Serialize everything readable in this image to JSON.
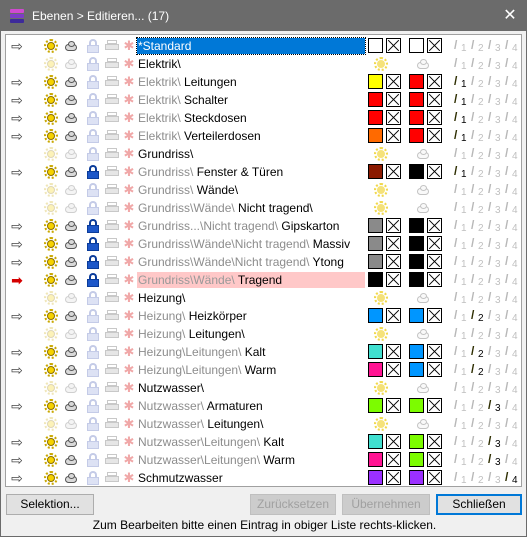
{
  "window": {
    "title": "Ebenen > Editieren... (17)",
    "close_glyph": "✕"
  },
  "layers": [
    {
      "arrow": "⇨",
      "visible": true,
      "locked": false,
      "path": "",
      "name": "*Standard",
      "selected": true,
      "colors": [
        "#ffffff",
        "#ffffff"
      ],
      "widths": [
        1,
        2,
        3,
        4
      ],
      "active_width": 0
    },
    {
      "arrow": "",
      "visible": false,
      "locked": false,
      "path": "",
      "name": "Elektrik\\",
      "group": true
    },
    {
      "arrow": "⇨",
      "visible": true,
      "locked": false,
      "path": "Elektrik\\ ",
      "name": "Leitungen",
      "colors": [
        "#ffff00",
        "#ff0000"
      ],
      "widths": [
        1,
        2,
        3,
        4
      ],
      "active_width": 1
    },
    {
      "arrow": "⇨",
      "visible": true,
      "locked": false,
      "path": "Elektrik\\ ",
      "name": "Schalter",
      "colors": [
        "#ff0000",
        "#ff0000"
      ],
      "widths": [
        1,
        2,
        3,
        4
      ],
      "active_width": 1
    },
    {
      "arrow": "⇨",
      "visible": true,
      "locked": false,
      "path": "Elektrik\\ ",
      "name": "Steckdosen",
      "colors": [
        "#ff0000",
        "#ff0000"
      ],
      "widths": [
        1,
        2,
        3,
        4
      ],
      "active_width": 1
    },
    {
      "arrow": "⇨",
      "visible": true,
      "locked": false,
      "path": "Elektrik\\ ",
      "name": "Verteilerdosen",
      "colors": [
        "#ff6a00",
        "#ff0000"
      ],
      "widths": [
        1,
        2,
        3,
        4
      ],
      "active_width": 1
    },
    {
      "arrow": "",
      "visible": false,
      "locked": false,
      "path": "",
      "name": "Grundriss\\",
      "group": true
    },
    {
      "arrow": "⇨",
      "visible": true,
      "locked": true,
      "path": "Grundriss\\ ",
      "name": "Fenster & Türen",
      "colors": [
        "#8b1a00",
        "#000000"
      ],
      "widths": [
        1,
        2,
        3,
        4
      ],
      "active_width": 1
    },
    {
      "arrow": "",
      "visible": false,
      "locked": false,
      "path": "Grundriss\\ ",
      "name": "Wände\\",
      "group": true
    },
    {
      "arrow": "",
      "visible": false,
      "locked": false,
      "path": "Grundriss\\Wände\\ ",
      "name": "Nicht tragend\\",
      "group": true
    },
    {
      "arrow": "⇨",
      "visible": true,
      "locked": true,
      "path": "Grundriss...\\Nicht tragend\\ ",
      "name": "Gipskarton",
      "colors": [
        "#8a8a8a",
        "#000000"
      ],
      "widths": [
        1,
        2,
        3,
        4
      ],
      "active_width": 0
    },
    {
      "arrow": "⇨",
      "visible": true,
      "locked": true,
      "path": "Grundriss\\Wände\\Nicht tragend\\ ",
      "name": "Massiv",
      "colors": [
        "#8a8a8a",
        "#000000"
      ],
      "widths": [
        1,
        2,
        3,
        4
      ],
      "active_width": 0
    },
    {
      "arrow": "⇨",
      "visible": true,
      "locked": true,
      "path": "Grundriss\\Wände\\Nicht tragend\\ ",
      "name": "Ytong",
      "colors": [
        "#8a8a8a",
        "#000000"
      ],
      "widths": [
        1,
        2,
        3,
        4
      ],
      "active_width": 0
    },
    {
      "arrow": "➡",
      "red_arrow": true,
      "visible": true,
      "locked": true,
      "path": "Grundriss\\Wände\\ ",
      "name": "Tragend",
      "highlight": true,
      "colors": [
        "#000000",
        "#000000"
      ],
      "widths": [
        1,
        2,
        3,
        4
      ],
      "active_width": 0
    },
    {
      "arrow": "",
      "visible": false,
      "locked": false,
      "path": "",
      "name": "Heizung\\",
      "group": true
    },
    {
      "arrow": "⇨",
      "visible": true,
      "locked": false,
      "path": "Heizung\\ ",
      "name": "Heizkörper",
      "colors": [
        "#0096ff",
        "#0096ff"
      ],
      "widths": [
        1,
        2,
        3,
        4
      ],
      "active_width": 2
    },
    {
      "arrow": "",
      "visible": false,
      "locked": false,
      "path": "Heizung\\ ",
      "name": "Leitungen\\",
      "group": true
    },
    {
      "arrow": "⇨",
      "visible": true,
      "locked": false,
      "path": "Heizung\\Leitungen\\ ",
      "name": "Kalt",
      "colors": [
        "#40e0d0",
        "#0096ff"
      ],
      "widths": [
        1,
        2,
        3,
        4
      ],
      "active_width": 2
    },
    {
      "arrow": "⇨",
      "visible": true,
      "locked": false,
      "path": "Heizung\\Leitungen\\ ",
      "name": "Warm",
      "colors": [
        "#ff1493",
        "#0096ff"
      ],
      "widths": [
        1,
        2,
        3,
        4
      ],
      "active_width": 2
    },
    {
      "arrow": "",
      "visible": false,
      "locked": false,
      "path": "",
      "name": "Nutzwasser\\",
      "group": true
    },
    {
      "arrow": "⇨",
      "visible": true,
      "locked": false,
      "path": "Nutzwasser\\ ",
      "name": "Armaturen",
      "colors": [
        "#7cfc00",
        "#7cfc00"
      ],
      "widths": [
        1,
        2,
        3,
        4
      ],
      "active_width": 3
    },
    {
      "arrow": "",
      "visible": false,
      "locked": false,
      "path": "Nutzwasser\\ ",
      "name": "Leitungen\\",
      "group": true
    },
    {
      "arrow": "⇨",
      "visible": true,
      "locked": false,
      "path": "Nutzwasser\\Leitungen\\ ",
      "name": "Kalt",
      "colors": [
        "#40e0d0",
        "#7cfc00"
      ],
      "widths": [
        1,
        2,
        3,
        4
      ],
      "active_width": 3
    },
    {
      "arrow": "⇨",
      "visible": true,
      "locked": false,
      "path": "Nutzwasser\\Leitungen\\ ",
      "name": "Warm",
      "colors": [
        "#ff1493",
        "#7cfc00"
      ],
      "widths": [
        1,
        2,
        3,
        4
      ],
      "active_width": 3
    },
    {
      "arrow": "⇨",
      "visible": true,
      "locked": false,
      "path": "",
      "name": "Schmutzwasser",
      "colors": [
        "#9b30ff",
        "#9b30ff"
      ],
      "widths": [
        1,
        2,
        3,
        4
      ],
      "active_width": 4
    }
  ],
  "buttons": {
    "selektion": "Selektion...",
    "zuruecksetzen": "Zurücksetzen",
    "uebernehmen": "Übernehmen",
    "schliessen": "Schließen"
  },
  "hint": "Zum Bearbeiten bitte einen Eintrag in obiger Liste rechts-klicken.",
  "icons": {
    "arrow": "arrow-right-icon",
    "sun": "visible-sun-icon",
    "cloud": "cloud-icon",
    "lock": "lock-icon",
    "print": "print-icon",
    "spark": "snap-icon"
  }
}
